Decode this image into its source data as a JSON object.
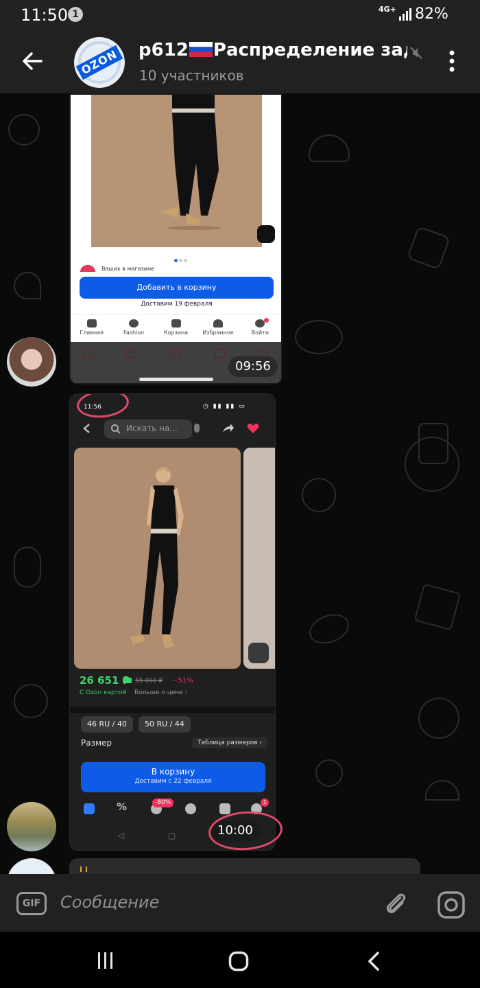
{
  "status_bar": {
    "time": "11:50",
    "notification_count": "1",
    "network": "4G+",
    "battery": "82%"
  },
  "header": {
    "avatar_logo": "OZON",
    "title": "р612",
    "title_rest": "Распределение зад",
    "subtitle": "10 участников"
  },
  "messages": [
    {
      "type": "screenshot",
      "theme": "light",
      "seller_text": "Ваших в магазине",
      "cart_button": "Добавить в корзину",
      "delivery": "Доставим 19 февраля",
      "nav": [
        "Главная",
        "Fashion",
        "Корзина",
        "Избранное",
        "Войти"
      ],
      "time": "09:56"
    },
    {
      "type": "screenshot",
      "theme": "dark",
      "phone_time": "11:56",
      "search_placeholder": "Искать на...",
      "price": "26 651 ₽",
      "old_price": "55 000 ₽",
      "discount": "−51%",
      "ozon_card": "С Ozon картой",
      "more_price": "Больше о цене ›",
      "sizes": [
        "46 RU / 40",
        "50 RU / 44"
      ],
      "size_label": "Размер",
      "size_table": "Таблица размеров ›",
      "cart_button": "В корзину",
      "delivery": "Доставим с 22 февраля",
      "sale_badge": "-80%",
      "cart_count": "1",
      "time": "10:00"
    }
  ],
  "input": {
    "gif_label": "GIF",
    "placeholder": "Сообщение"
  },
  "colors": {
    "header_bg": "#212121",
    "accent_blue": "#0e5be8",
    "price_green": "#3fd16a",
    "highlight_circle": "#e14a6b"
  }
}
